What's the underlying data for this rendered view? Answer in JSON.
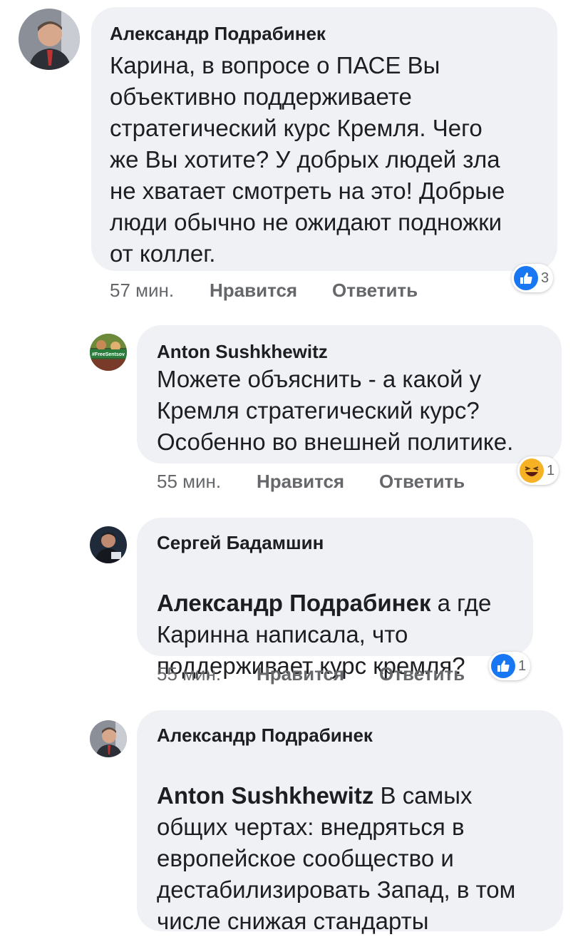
{
  "comments": [
    {
      "author": "Александр Подрабинек",
      "mention": "",
      "text": "Карина, в вопросе о ПАСЕ Вы\nобъективно поддерживаете\nстратегический курс Кремля. Чего\nже Вы хотите? У добрых людей зла\nне хватает смотреть на это! Добрые\nлюди обычно не ожидают подножки\nот коллег.",
      "time": "57 мин.",
      "like_label": "Нравится",
      "reply_label": "Ответить",
      "reaction": "like-icon",
      "reaction_count": "3"
    },
    {
      "author": "Anton Sushkhewitz",
      "mention": "",
      "text": "Можете объяснить - а какой у\nКремля стратегический курс?\nОсобенно во внешней политике.",
      "time": "55 мин.",
      "like_label": "Нравится",
      "reply_label": "Ответить",
      "reaction": "haha-icon",
      "reaction_count": "1"
    },
    {
      "author": "Сергей Бадамшин",
      "mention": "Александр Подрабинек",
      "text": " а где\nКаринна написала, что\nподдерживает курс кремля?",
      "time": "55 мин.",
      "like_label": "Нравится",
      "reply_label": "Ответить",
      "reaction": "like-icon",
      "reaction_count": "1"
    },
    {
      "author": "Александр Подрабинек",
      "mention": "Anton Sushkhewitz",
      "text": " В самых\nобщих чертах: внедряться в\nевропейское сообщество и\nдестабилизировать Запад, в том\nчисле снижая стандарты",
      "time": "",
      "like_label": "",
      "reply_label": "",
      "reaction": "",
      "reaction_count": ""
    }
  ],
  "avatar_2_badge": "#FreeSentsov",
  "colors": {
    "bubble": "#eff1f4",
    "meta": "#65676b",
    "like": "#1877f2",
    "haha": "#f7b125"
  }
}
